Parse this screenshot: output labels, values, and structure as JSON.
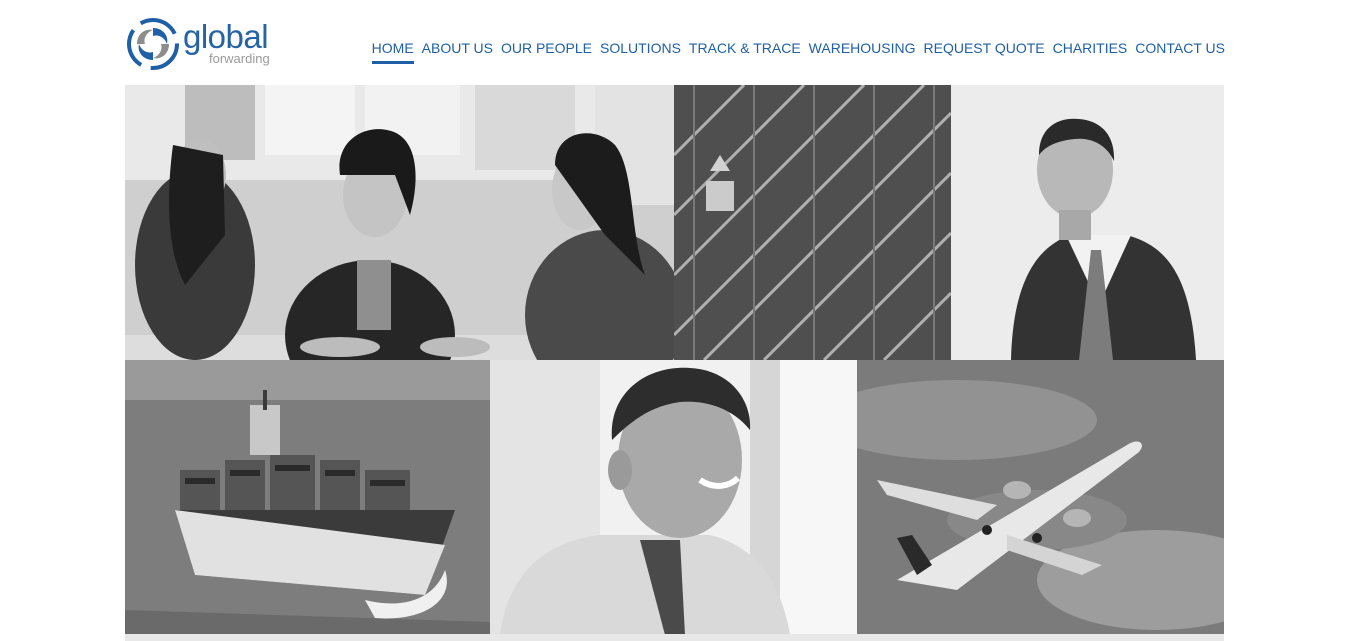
{
  "brand": {
    "name": "global",
    "tagline": "forwarding",
    "primary_color": "#1f5fa6",
    "secondary_color": "#9a9a9a",
    "icon": "swirl-logo-icon"
  },
  "nav": {
    "items": [
      {
        "label": "HOME",
        "active": true
      },
      {
        "label": "ABOUT US"
      },
      {
        "label": "OUR PEOPLE"
      },
      {
        "label": "SOLUTIONS"
      },
      {
        "label": "TRACK & TRACE"
      },
      {
        "label": "WAREHOUSING"
      },
      {
        "label": "REQUEST QUOTE"
      },
      {
        "label": "CHARITIES"
      },
      {
        "label": "CONTACT US"
      }
    ]
  },
  "gallery": {
    "style": "black-and-white photographs",
    "photos": [
      {
        "icon": "team-photo"
      },
      {
        "icon": "shipping-containers-photo"
      },
      {
        "icon": "businessman-portrait-photo"
      },
      {
        "icon": "container-ship-photo"
      },
      {
        "icon": "smiling-man-photo"
      },
      {
        "icon": "airplane-photo"
      }
    ]
  }
}
